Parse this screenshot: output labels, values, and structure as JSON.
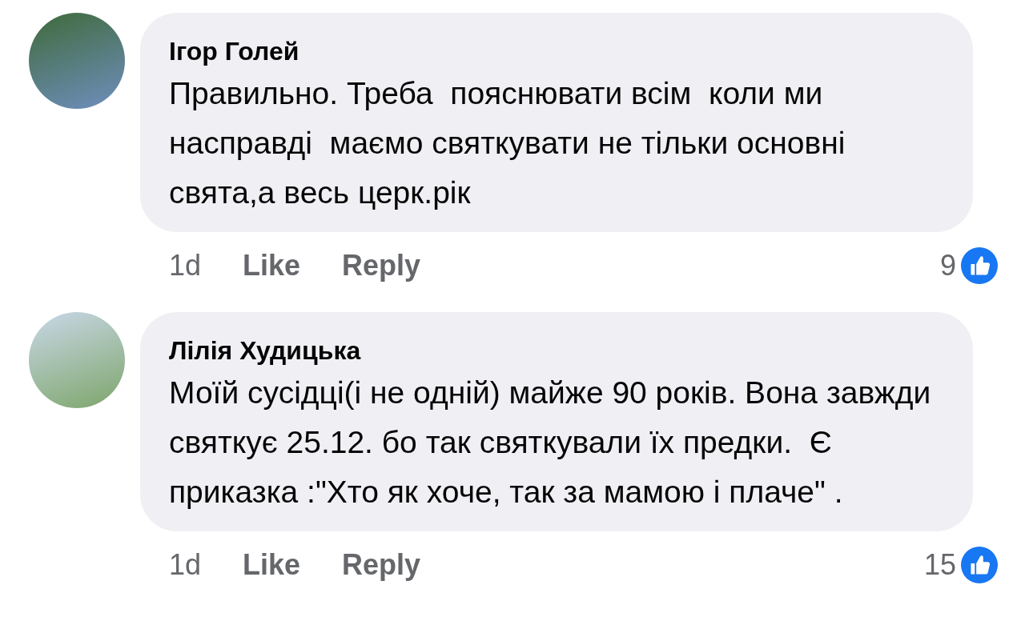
{
  "comments": [
    {
      "author": "Ігор Голей",
      "text": "Правильно. Треба  пояснювати всім  коли ми насправді  маємо святкувати не тільки основні  свята,а весь церк.рік",
      "time": "1d",
      "like": "Like",
      "reply": "Reply",
      "reactions": "9"
    },
    {
      "author": "Лілія Худицька",
      "text": "Моїй сусідці(і не одній) майже 90 років. Вона завжди святкує 25.12. бо так святкували їх предки.  Є приказка :\"Хто як хоче, так за мамою і плаче\" .",
      "time": "1d",
      "like": "Like",
      "reply": "Reply",
      "reactions": "15"
    }
  ]
}
